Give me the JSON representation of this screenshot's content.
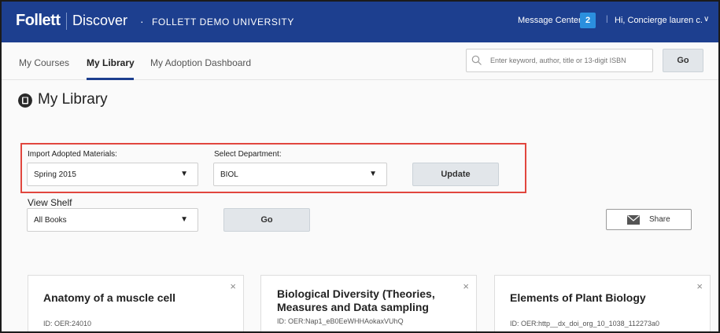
{
  "header": {
    "brand": "Follett",
    "product": "Discover",
    "separator": "·",
    "university": "FOLLETT DEMO UNIVERSITY",
    "message_center_label": "Message Center",
    "message_count": "2",
    "divider": "|",
    "greeting": "Hi, Concierge lauren c.",
    "greeting_chevron_icon": "chevron-down-icon"
  },
  "nav": {
    "tabs": [
      {
        "label": "My Courses",
        "active": false
      },
      {
        "label": "My Library",
        "active": true
      },
      {
        "label": "My Adoption Dashboard",
        "active": false
      }
    ],
    "search": {
      "placeholder": "Enter keyword, author, title or 13-digit ISBN",
      "icon": "search-icon",
      "go_label": "Go"
    }
  },
  "page": {
    "title": "My Library",
    "title_icon": "book-icon"
  },
  "import": {
    "import_label": "Import Adopted Materials:",
    "import_value": "Spring 2015",
    "department_label": "Select Department:",
    "department_value": "BIOL",
    "update_label": "Update",
    "highlight_color": "#e1463e"
  },
  "shelf": {
    "label": "View Shelf",
    "value": "All Books",
    "go_label": "Go",
    "share_label": "Share",
    "share_icon": "envelope-icon"
  },
  "cards": [
    {
      "title": "Anatomy of a muscle cell",
      "id": "ID: OER:24010"
    },
    {
      "title": "Biological Diversity (Theories, Measures and Data sampling",
      "id": "ID: OER:Nap1_eB0EeWHHAokaxVUhQ"
    },
    {
      "title": "Elements of Plant Biology",
      "id": "ID: OER:http__dx_doi_org_10_1038_112273a0"
    }
  ],
  "colors": {
    "header_bg": "#1d3f8f",
    "badge_bg": "#2b8fde",
    "accent": "#1d3f8f"
  },
  "symbols": {
    "dropdown_arrow": "▼",
    "close": "×",
    "chevron": "∨"
  }
}
